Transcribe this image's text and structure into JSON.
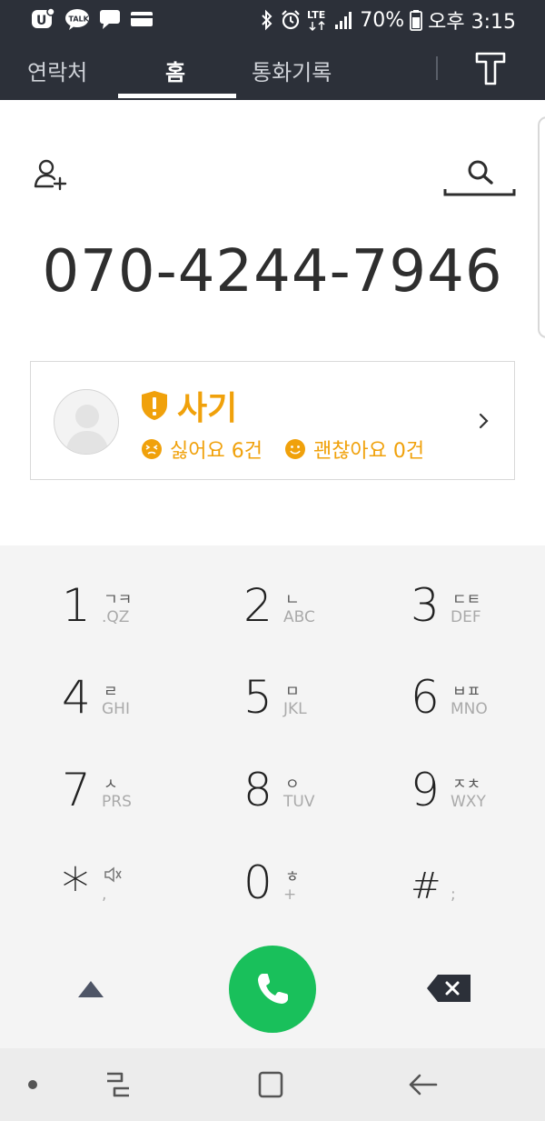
{
  "status_bar": {
    "left_icons": [
      "u-plus-icon",
      "kakaotalk-icon",
      "message-icon",
      "card-icon"
    ],
    "kakaotalk_label": "TALK",
    "right_icons": [
      "bluetooth-icon",
      "alarm-icon",
      "lte-icon",
      "signal-icon",
      "battery-icon"
    ],
    "lte_label": "LTE",
    "battery": "70%",
    "time": "오후 3:15"
  },
  "tabs": {
    "contacts": "연락처",
    "home": "홈",
    "call_log": "통화기록",
    "active": "home",
    "t_label": "T"
  },
  "header": {
    "add_contact_icon": "add-contact-icon",
    "search_icon": "search-icon"
  },
  "phone_number": "070-4244-7946",
  "info_card": {
    "title": "사기",
    "dislike_label": "싫어요 6건",
    "like_label": "괜찮아요 0건",
    "accent": "#f0a10b"
  },
  "dialpad": {
    "keys": [
      {
        "digit": "1",
        "ko": "ㄱㅋ",
        "en": ".QZ"
      },
      {
        "digit": "2",
        "ko": "ㄴ",
        "en": "ABC"
      },
      {
        "digit": "3",
        "ko": "ㄷㅌ",
        "en": "DEF"
      },
      {
        "digit": "4",
        "ko": "ㄹ",
        "en": "GHI"
      },
      {
        "digit": "5",
        "ko": "ㅁ",
        "en": "JKL"
      },
      {
        "digit": "6",
        "ko": "ㅂㅍ",
        "en": "MNO"
      },
      {
        "digit": "7",
        "ko": "ㅅ",
        "en": "PRS"
      },
      {
        "digit": "8",
        "ko": "ㅇ",
        "en": "TUV"
      },
      {
        "digit": "9",
        "ko": "ㅈㅊ",
        "en": "WXY"
      },
      {
        "digit": "*",
        "ko": "",
        "en": ","
      },
      {
        "digit": "0",
        "ko": "ㅎ",
        "en": "+"
      },
      {
        "digit": "#",
        "ko": "",
        "en": ";"
      }
    ],
    "call_color": "#19c05b"
  },
  "nav_bar": {
    "icons": [
      "recent-apps-icon",
      "home-icon",
      "back-icon"
    ]
  }
}
